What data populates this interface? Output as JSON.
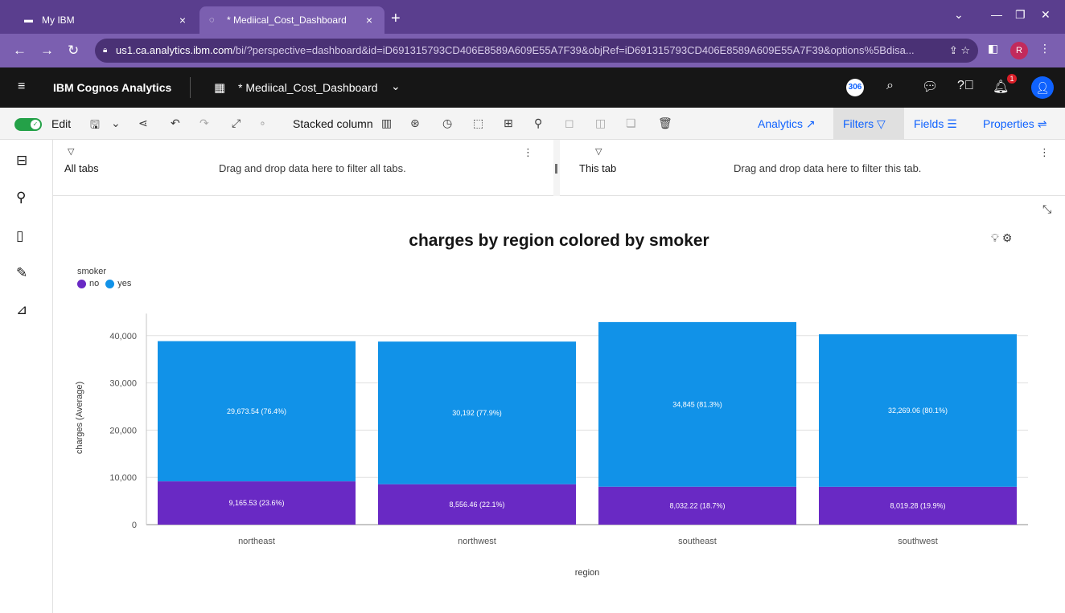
{
  "browser": {
    "tabs": [
      {
        "title": "My IBM",
        "close": "×"
      },
      {
        "title": "* Mediical_Cost_Dashboard",
        "close": "×"
      }
    ],
    "new_tab": "+",
    "url_host": "us1.ca.analytics.ibm.com",
    "url_path": "/bi/?perspective=dashboard&id=iD691315793CD406E8589A609E55A7F39&objRef=iD691315793CD406E8589A609E55A7F39&options%5Bdisa...",
    "profile_initial": "R"
  },
  "app": {
    "brand": "IBM Cognos Analytics",
    "dashboard_name": "* Mediical_Cost_Dashboard",
    "badge": "306",
    "notification_count": "1"
  },
  "toolbar": {
    "edit_label": "Edit",
    "chart_type_label": "Stacked column",
    "analytics_label": "Analytics",
    "filters_label": "Filters",
    "fields_label": "Fields",
    "properties_label": "Properties"
  },
  "filters": {
    "all_tabs_label": "All tabs",
    "all_tabs_hint": "Drag and drop data here to filter all tabs.",
    "this_tab_label": "This tab",
    "this_tab_hint": "Drag and drop data here to filter this tab."
  },
  "icons": {
    "hamburger": "menu-icon",
    "search": "search-icon",
    "chat": "chat-icon",
    "help": "help-icon",
    "notifications": "bell-icon",
    "user": "user-icon",
    "save": "save-icon",
    "share": "share-icon",
    "undo": "undo-icon",
    "redo": "redo-icon",
    "trash": "trash-icon",
    "funnel": "funnel-icon"
  },
  "colors": {
    "no": "#6929c4",
    "yes": "#1192e8"
  },
  "chart_data": {
    "type": "bar",
    "stacked": true,
    "title": "charges by region colored by smoker",
    "xlabel": "region",
    "ylabel": "charges (Average)",
    "legend_title": "smoker",
    "legend_position": "top-left",
    "categories": [
      "northeast",
      "northwest",
      "southeast",
      "southwest"
    ],
    "series": [
      {
        "name": "no",
        "values": [
          9165.53,
          8556.46,
          8032.22,
          8019.28
        ],
        "labels": [
          "9,165.53 (23.6%)",
          "8,556.46 (22.1%)",
          "8,032.22 (18.7%)",
          "8,019.28 (19.9%)"
        ]
      },
      {
        "name": "yes",
        "values": [
          29673.54,
          30192,
          34845,
          32269.06
        ],
        "labels": [
          "29,673.54 (76.4%)",
          "30,192 (77.9%)",
          "34,845 (81.3%)",
          "32,269.06 (80.1%)"
        ]
      }
    ],
    "yticks": [
      "0",
      "10,000",
      "20,000",
      "30,000",
      "40,000"
    ],
    "ytick_values": [
      0,
      10000,
      20000,
      30000,
      40000
    ],
    "ylim": [
      0,
      45000
    ],
    "grid": true
  }
}
